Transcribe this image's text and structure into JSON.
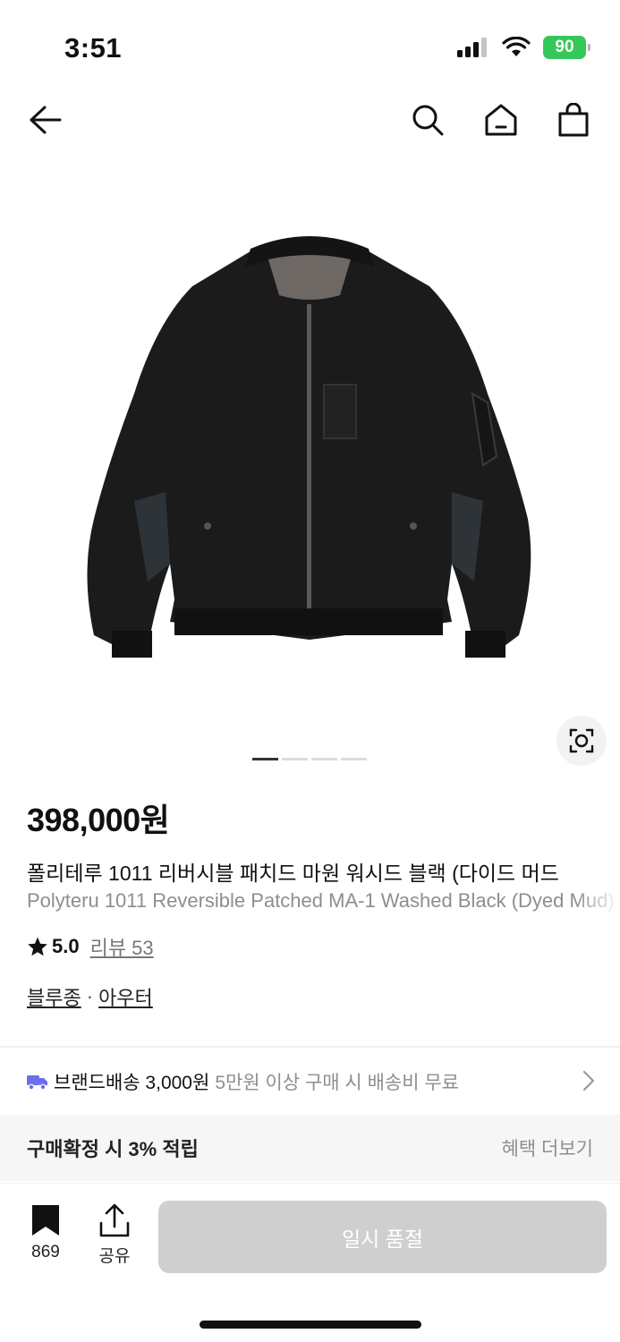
{
  "status_bar": {
    "time": "3:51",
    "battery": "90"
  },
  "nav": {
    "icons": [
      "back-arrow-icon",
      "search-icon",
      "home-icon",
      "shopping-bag-icon"
    ]
  },
  "product": {
    "price": "398,000원",
    "name_ko": "폴리테루 1011 리버시블 패치드 마원 워시드 블랙 (다이드 머드",
    "name_en": "Polyteru 1011 Reversible Patched MA-1 Washed Black (Dyed Mud)",
    "rating_score": "5.0",
    "review_label": "리뷰 53",
    "categories": [
      "블루종",
      "아우터"
    ],
    "category_separator": "·",
    "image_pages": 4,
    "active_page": 1
  },
  "shipping": {
    "label": "브랜드배송 3,000원",
    "condition": "5만원 이상 구매 시 배송비 무료",
    "icon": "truck-icon"
  },
  "points": {
    "label": "구매확정 시 3% 적립",
    "more": "혜택 더보기"
  },
  "bottom_bar": {
    "bookmark_count": "869",
    "share_label": "공유",
    "buy_button": "일시 품절"
  },
  "colors": {
    "battery": "#34c759",
    "truck": "#6b6fe8",
    "disabled_button": "#cfcfcf"
  }
}
